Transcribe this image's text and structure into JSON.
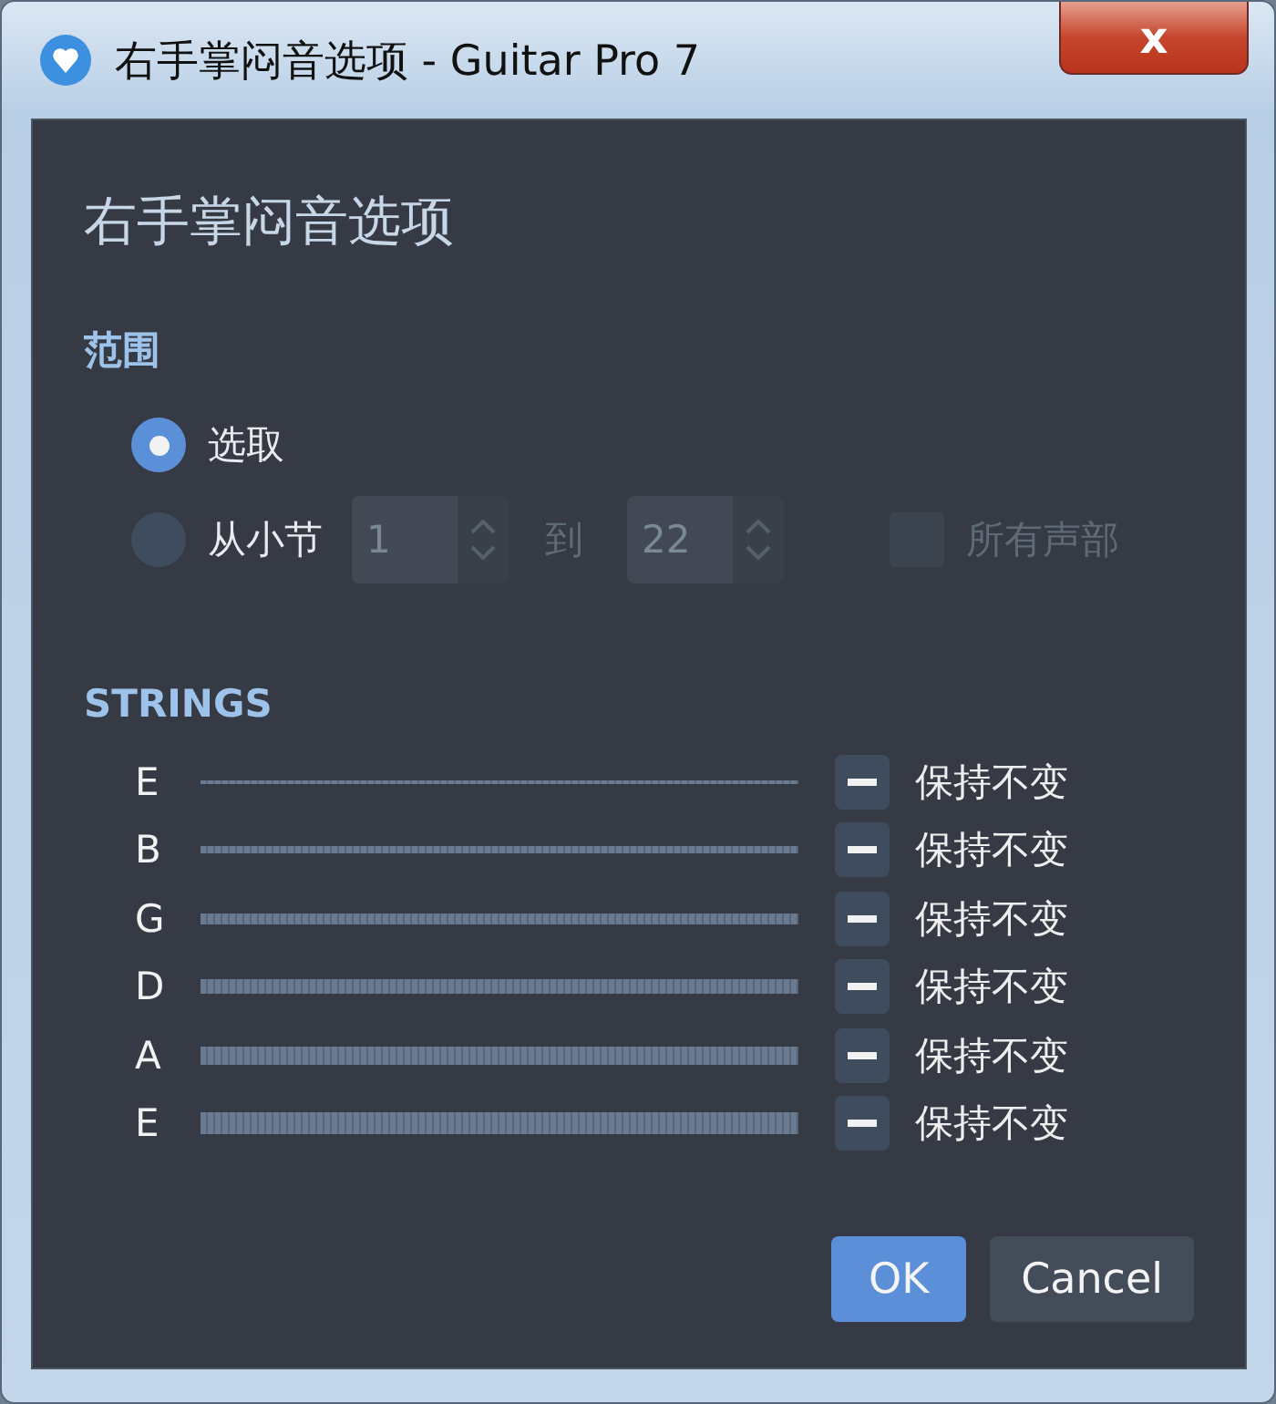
{
  "window": {
    "title": "右手掌闷音选项 - Guitar Pro 7",
    "close": "x"
  },
  "heading": "右手掌闷音选项",
  "range": {
    "title": "范围",
    "options": [
      {
        "label": "选取",
        "selected": true,
        "disabled": false
      },
      {
        "label": "从小节",
        "selected": false,
        "disabled": false
      }
    ],
    "from": {
      "value": "1",
      "disabled": true
    },
    "to_label": "到",
    "to": {
      "value": "22",
      "disabled": true
    },
    "all_voices": {
      "label": "所有声部",
      "checked": false,
      "disabled": true
    }
  },
  "strings_title": "STRINGS",
  "strings": [
    {
      "name": "E",
      "action": "保持不变"
    },
    {
      "name": "B",
      "action": "保持不变"
    },
    {
      "name": "G",
      "action": "保持不变"
    },
    {
      "name": "D",
      "action": "保持不变"
    },
    {
      "name": "A",
      "action": "保持不变"
    },
    {
      "name": "E",
      "action": "保持不变"
    }
  ],
  "buttons": [
    {
      "label": "OK",
      "kind": "primary"
    },
    {
      "label": "Cancel",
      "kind": "secondary"
    }
  ]
}
